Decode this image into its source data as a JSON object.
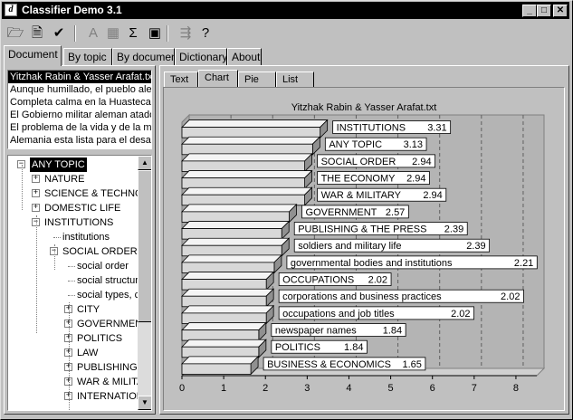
{
  "window": {
    "title": "Classifier Demo 3.1",
    "app_icon": "d"
  },
  "caption_buttons": [
    {
      "name": "minimize-button",
      "glyph": "_"
    },
    {
      "name": "maximize-button",
      "glyph": "□"
    },
    {
      "name": "close-button",
      "glyph": "✕"
    }
  ],
  "toolbar": [
    {
      "name": "open-folder-icon",
      "glyph": "🗁",
      "disabled": false
    },
    {
      "name": "new-document-icon",
      "glyph": "🗎",
      "disabled": false
    },
    {
      "name": "checkmark-icon",
      "glyph": "✔",
      "disabled": false
    },
    {
      "name": "font-icon",
      "glyph": "A",
      "disabled": true
    },
    {
      "name": "document-icon",
      "glyph": "▦",
      "disabled": true
    },
    {
      "name": "sigma-icon",
      "glyph": "Σ",
      "disabled": false
    },
    {
      "name": "film-icon",
      "glyph": "▣",
      "disabled": false
    },
    {
      "name": "compare-icon",
      "glyph": "⇶",
      "disabled": true
    },
    {
      "name": "help-icon",
      "glyph": "?",
      "disabled": false
    }
  ],
  "main_tabs": [
    "Document",
    "By topic",
    "By document",
    "Dictionary",
    "About"
  ],
  "documents": [
    "Yitzhak Rabin & Yasser Arafat.txt",
    "Aunque humillado, el pueblo alemán",
    "Completa calma en la Huasteca de",
    "El Gobierno militar aleman atado de",
    "El problema de la vida y de la muerte",
    "Alemania esta lista para el desarme"
  ],
  "tree": [
    {
      "label": "ANY TOPIC",
      "level": 0,
      "expander": "−",
      "selected": true
    },
    {
      "label": "NATURE",
      "level": 1,
      "expander": "+"
    },
    {
      "label": "SCIENCE & TECHNOLOGY",
      "level": 1,
      "expander": "+"
    },
    {
      "label": "DOMESTIC LIFE",
      "level": 1,
      "expander": "+"
    },
    {
      "label": "INSTITUTIONS",
      "level": 1,
      "expander": "−"
    },
    {
      "label": "institutions",
      "level": 2,
      "expander": ""
    },
    {
      "label": "SOCIAL ORDER",
      "level": 2,
      "expander": "−"
    },
    {
      "label": "social order",
      "level": 3,
      "expander": ""
    },
    {
      "label": "social structure",
      "level": 3,
      "expander": ""
    },
    {
      "label": "social types, classes",
      "level": 3,
      "expander": ""
    },
    {
      "label": "CITY",
      "level": 3,
      "expander": "+"
    },
    {
      "label": "GOVERNMENT",
      "level": 3,
      "expander": "+"
    },
    {
      "label": "POLITICS",
      "level": 3,
      "expander": "+"
    },
    {
      "label": "LAW",
      "level": 3,
      "expander": "+"
    },
    {
      "label": "PUBLISHING",
      "level": 3,
      "expander": "+"
    },
    {
      "label": "WAR & MILITARY",
      "level": 3,
      "expander": "+"
    },
    {
      "label": "INTERNATIONAL",
      "level": 3,
      "expander": "+"
    }
  ],
  "sub_tabs": [
    "Text",
    "Chart",
    "Pie",
    "List"
  ],
  "chart_data": {
    "type": "bar",
    "orientation": "horizontal",
    "title": "Yitzhak Rabin & Yasser Arafat.txt",
    "categories": [
      "INSTITUTIONS",
      "ANY TOPIC",
      "SOCIAL ORDER",
      "THE ECONOMY",
      "WAR & MILITARY",
      "GOVERNMENT",
      "PUBLISHING & THE PRESS",
      "soldiers and military life",
      "governmental bodies and institutions",
      "OCCUPATIONS",
      "corporations and business practices",
      "occupations and job titles",
      "newspaper names",
      "POLITICS",
      "BUSINESS & ECONOMICS"
    ],
    "values": [
      3.31,
      3.13,
      2.94,
      2.94,
      2.94,
      2.57,
      2.39,
      2.39,
      2.21,
      2.02,
      2.02,
      2.02,
      1.84,
      1.84,
      1.65
    ],
    "xlim": [
      0,
      8.5
    ],
    "xticks": [
      0,
      1,
      2,
      3,
      4,
      5,
      6,
      7,
      8
    ],
    "grid": true,
    "style": "3d"
  }
}
